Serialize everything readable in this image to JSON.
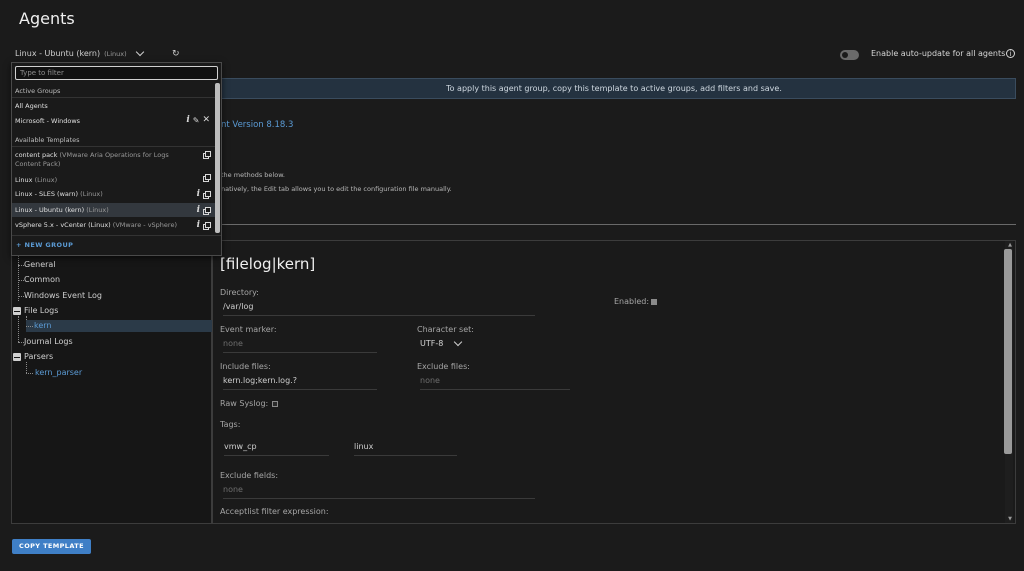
{
  "page": {
    "title": "Agents"
  },
  "agent_select": {
    "name": "Linux - Ubuntu (kern)",
    "os": "(Linux)"
  },
  "auto_update": {
    "label": "Enable auto-update for all agents",
    "enabled": false
  },
  "banner": {
    "text": "To apply this agent group, copy this template to active groups, add filters and save."
  },
  "info": {
    "version_text": "nt Version 8.18.3",
    "methods_text": "the methods below.",
    "edit_text": "natively, the Edit tab allows you to edit the configuration file manually."
  },
  "dropdown": {
    "filter_placeholder": "Type to filter",
    "active_header": "Active Groups",
    "active_groups": [
      {
        "name": "All Agents",
        "sub": ""
      },
      {
        "name": "Microsoft - Windows",
        "sub": ""
      }
    ],
    "templates_header": "Available Templates",
    "templates": [
      {
        "name": "content pack",
        "sub": "(VMware Aria Operations for Logs Content Pack)"
      },
      {
        "name": "Linux",
        "sub": "(Linux)"
      },
      {
        "name": "Linux - SLES (warn)",
        "sub": "(Linux)"
      },
      {
        "name": "Linux - Ubuntu (kern)",
        "sub": "(Linux)"
      },
      {
        "name": "vSphere 5.x - vCenter (Linux)",
        "sub": "(VMware - vSphere)"
      }
    ],
    "new_group_label": "+ NEW GROUP"
  },
  "tree": {
    "general": "General",
    "common": "Common",
    "windows_event_log": "Windows Event Log",
    "file_logs": "File Logs",
    "kern": "kern",
    "journal_logs": "Journal Logs",
    "parsers": "Parsers",
    "kern_parser": "kern_parser"
  },
  "config": {
    "section_title": "[filelog|kern]",
    "directory_label": "Directory:",
    "directory_value": "/var/log",
    "enabled_label": "Enabled:",
    "enabled_checked": true,
    "event_marker_label": "Event marker:",
    "event_marker_placeholder": "none",
    "charset_label": "Character set:",
    "charset_value": "UTF-8",
    "include_label": "Include files:",
    "include_value": "kern.log;kern.log.?",
    "exclude_files_label": "Exclude files:",
    "exclude_files_placeholder": "none",
    "raw_syslog_label": "Raw Syslog:",
    "raw_syslog_checked": false,
    "tags_label": "Tags:",
    "tag_key": "vmw_cp",
    "tag_value": "linux",
    "exclude_fields_label": "Exclude fields:",
    "exclude_fields_placeholder": "none",
    "acceptlist_label": "Acceptlist filter expression:"
  },
  "actions": {
    "copy_template": "COPY TEMPLATE"
  },
  "colors": {
    "accent": "#3f7fc6",
    "link": "#5b9bd5",
    "background": "#1b1b1b"
  }
}
